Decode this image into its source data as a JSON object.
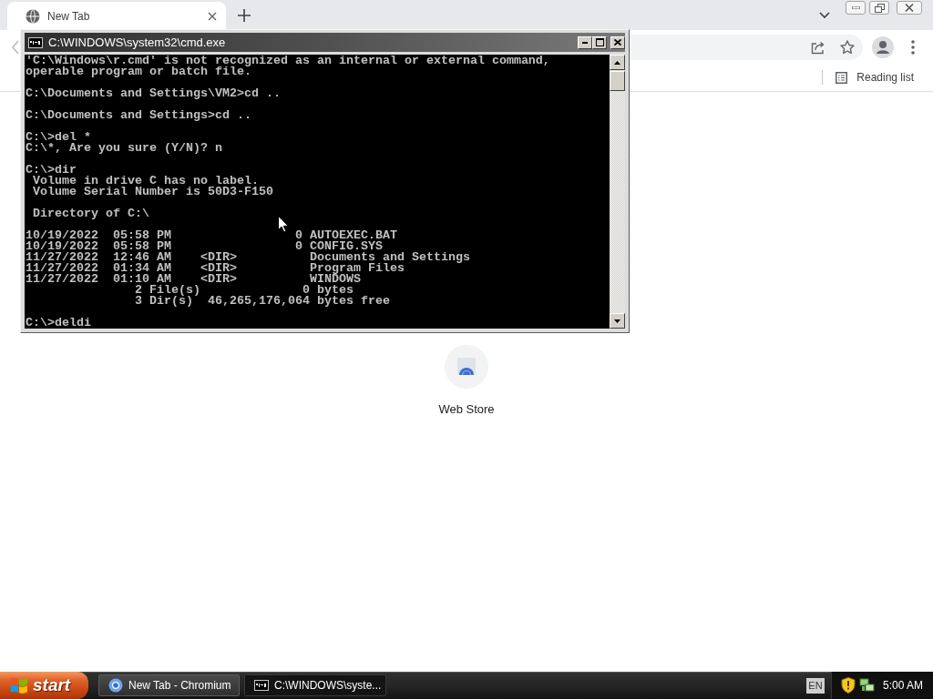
{
  "browser": {
    "tabs": [
      {
        "title": "New Tab",
        "selected": true
      }
    ],
    "bookmarks_bar": {
      "items": [
        {
          "label": "Reading list"
        }
      ]
    },
    "shortcuts": [
      {
        "label": "Web Store"
      }
    ]
  },
  "console_window": {
    "title": "C:\\WINDOWS\\system32\\cmd.exe",
    "blocks": [
      [
        "'C:\\Windows\\r.cmd' is not recognized as an internal or external command,",
        "operable program or batch file."
      ],
      [
        "C:\\Documents and Settings\\VM2>cd .."
      ],
      [
        "C:\\Documents and Settings>cd .."
      ],
      [
        "C:\\>del *",
        "C:\\*, Are you sure (Y/N)? n"
      ],
      [
        "C:\\>dir",
        " Volume in drive C has no label.",
        " Volume Serial Number is 50D3-F150"
      ],
      [
        " Directory of C:\\"
      ],
      [
        "10/19/2022  05:58 PM                 0 AUTOEXEC.BAT",
        "10/19/2022  05:58 PM                 0 CONFIG.SYS",
        "11/27/2022  12:46 AM    <DIR>          Documents and Settings",
        "11/27/2022  01:34 AM    <DIR>          Program Files",
        "11/27/2022  01:10 AM    <DIR>          WINDOWS",
        "               2 File(s)              0 bytes",
        "               3 Dir(s)  46,265,176,064 bytes free"
      ],
      [
        "C:\\>deldi"
      ]
    ]
  },
  "taskbar": {
    "start_label": "start",
    "tasks": [
      {
        "kind": "browser",
        "label": "New Tab - Chromium",
        "selected": false
      },
      {
        "kind": "console",
        "label": "C:\\WINDOWS\\syste...",
        "selected": true
      }
    ],
    "language": "EN",
    "clock": "5:00 AM"
  }
}
